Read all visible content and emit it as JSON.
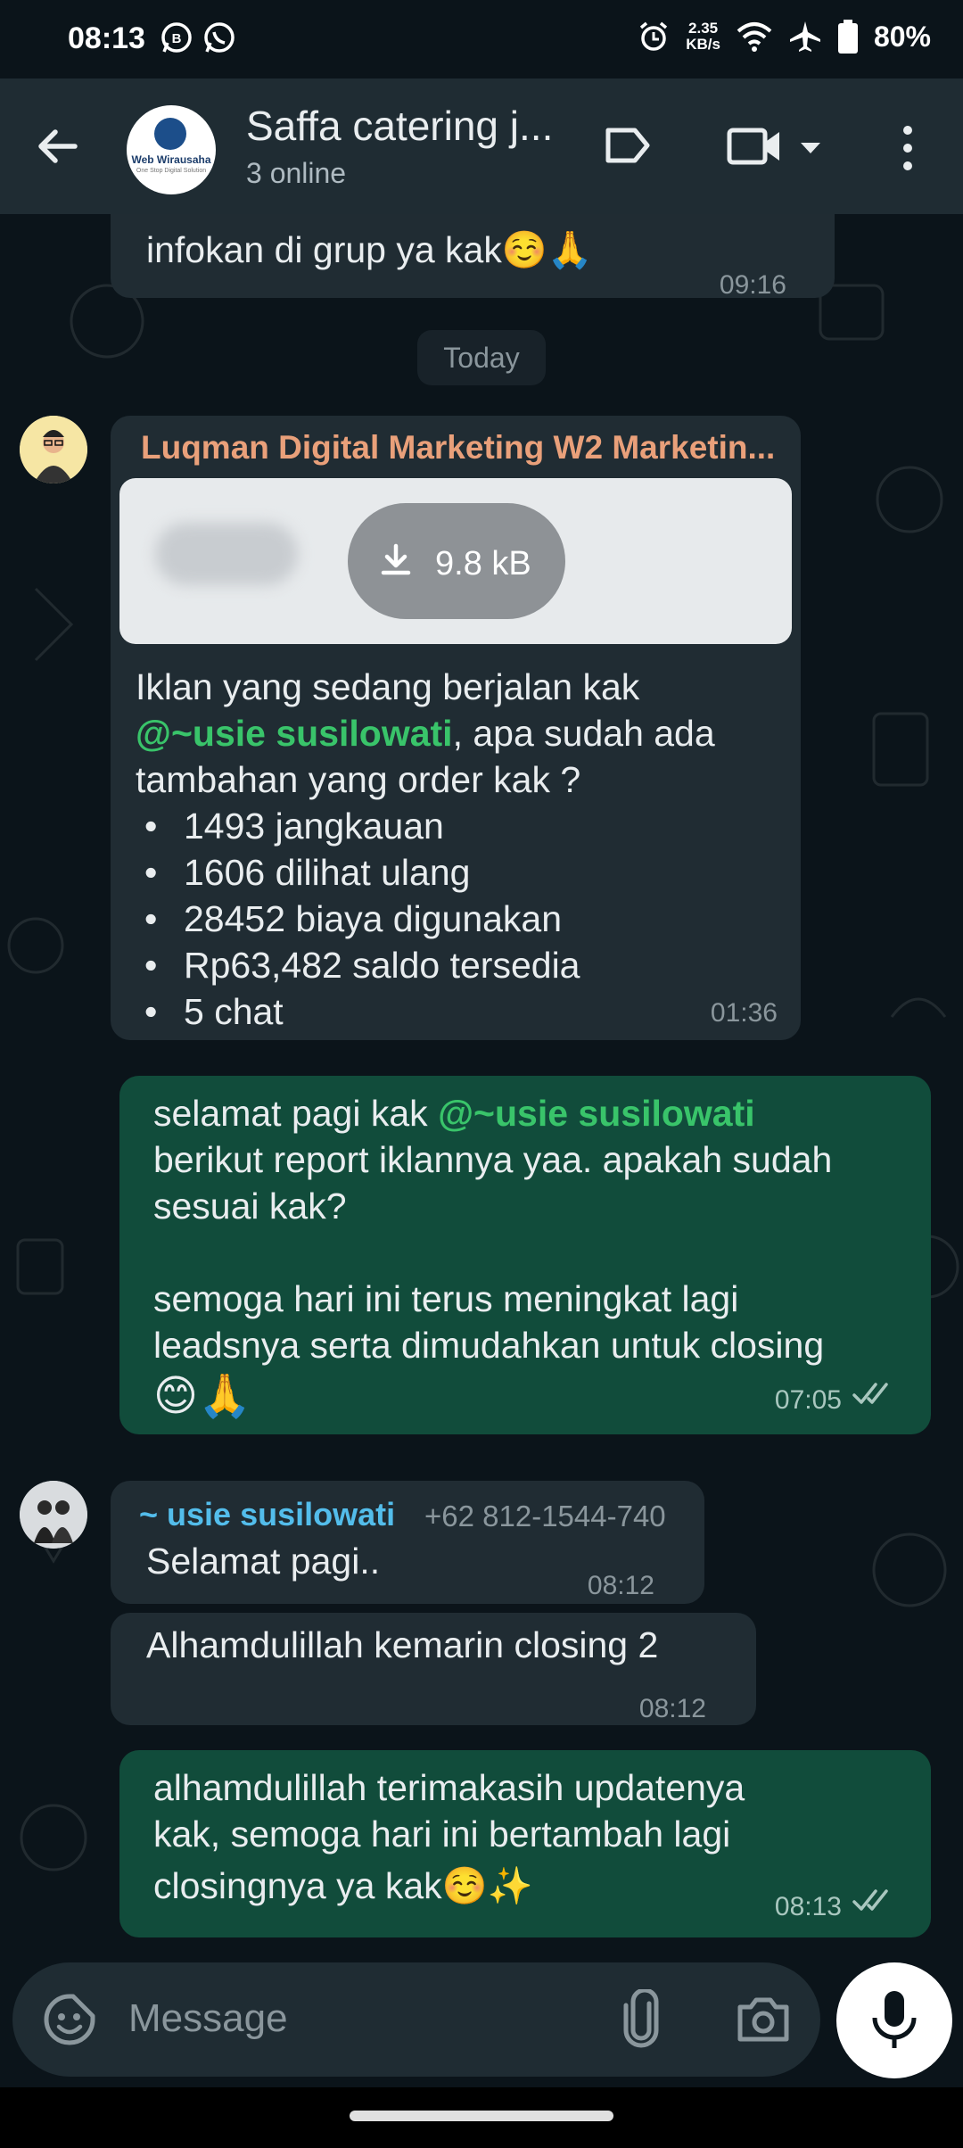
{
  "status_bar": {
    "time": "08:13",
    "net_speed_value": "2.35",
    "net_speed_unit": "KB/s",
    "battery": "80%"
  },
  "header": {
    "title": "Saffa catering j...",
    "subtitle": "3 online",
    "avatar_logo_text": "Web Wirausaha",
    "avatar_logo_sub": "One Stop Digital Solution"
  },
  "messages": {
    "m0": {
      "text": "infokan di grup ya kak☺️🙏",
      "time": "09:16"
    },
    "date_chip": "Today",
    "m1": {
      "sender": "Luqman Digital Marketing W2 Marketin...",
      "attachment_size": "9.8 kB",
      "line1": "Iklan yang sedang berjalan kak",
      "mention": "@~usie susilowati",
      "after_mention": ", apa sudah ada",
      "line3": "tambahan yang order kak ?",
      "bullets": [
        "1493 jangkauan",
        "1606 dilihat ulang",
        "28452 biaya digunakan",
        "Rp63,482 saldo tersedia",
        "5 chat"
      ],
      "time": "01:36"
    },
    "m2": {
      "prefix": "selamat pagi kak ",
      "mention": "@~usie susilowati",
      "line2": "berikut report iklannya yaa. apakah sudah",
      "line3": "sesuai kak?",
      "line4": "semoga hari ini terus meningkat lagi",
      "line5": "leadsnya serta dimudahkan untuk closing",
      "line6": "😊🙏",
      "time": "07:05"
    },
    "m3": {
      "sender": "~ usie susilowati",
      "phone": "+62 812-1544-740",
      "text": "Selamat pagi..",
      "time": "08:12"
    },
    "m4": {
      "text": "Alhamdulillah kemarin closing 2",
      "time": "08:12"
    },
    "m5": {
      "line1": "alhamdulillah terimakasih updatenya",
      "line2": "kak, semoga hari ini bertambah lagi",
      "line3": "closingnya ya kak☺️✨",
      "time": "08:13"
    }
  },
  "input": {
    "placeholder": "Message"
  },
  "colors": {
    "background": "#0b141a",
    "incoming_bubble": "#202c33",
    "outgoing_bubble": "#114c3b",
    "mention": "#39c46a",
    "sender_luqman": "#e9a07a",
    "sender_usie": "#53bdeb"
  },
  "icons": [
    "whatsapp-business-icon",
    "whatsapp-icon",
    "alarm-icon",
    "wifi-icon",
    "airplane-icon",
    "battery-icon",
    "back-arrow-icon",
    "label-icon",
    "video-call-icon",
    "chevron-down-icon",
    "more-vert-icon",
    "download-icon",
    "double-check-icon",
    "emoji-icon",
    "attach-icon",
    "camera-icon",
    "mic-icon"
  ]
}
